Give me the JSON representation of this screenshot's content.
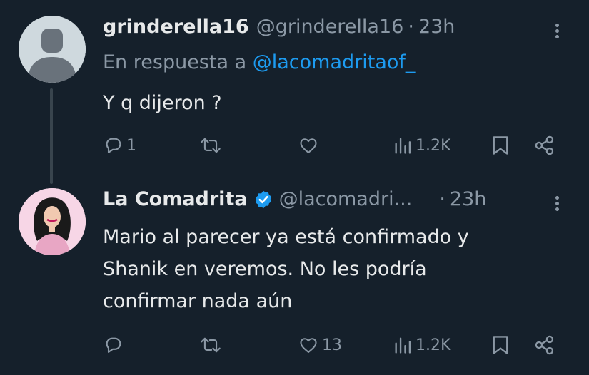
{
  "tweet1": {
    "display_name": "grinderella16",
    "handle": "@grinderella16",
    "dot": "·",
    "time": "23h",
    "reply_label": "En respuesta a",
    "reply_mention": "@lacomadritaof_",
    "text": "Y q dijeron ?",
    "replies": "1",
    "retweets": "",
    "likes": "",
    "views": "1.2K",
    "avatar_icon": "default-user-avatar"
  },
  "tweet2": {
    "display_name": "La Comadrita",
    "handle": "@lacomadri...",
    "dot": "·",
    "time": "23h",
    "text_line1": "Mario al parecer ya está confirmado y",
    "text_line2": "Shanik en veremos. No les podría",
    "text_line3": "confirmar nada aún",
    "replies": "",
    "retweets": "",
    "likes": "13",
    "views": "1.2K",
    "verified_icon": "verified-badge-icon",
    "avatar_icon": "woman-illustration-avatar"
  },
  "colors": {
    "background": "#15202b",
    "text": "#e7e9ea",
    "muted": "#8b98a5",
    "accent": "#1d9bf0"
  }
}
